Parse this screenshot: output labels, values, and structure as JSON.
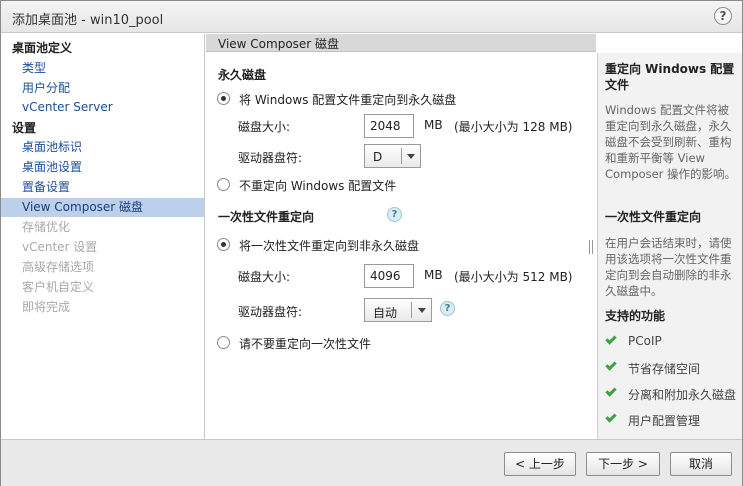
{
  "window": {
    "title": "添加桌面池 - win10_pool",
    "help_label": "?"
  },
  "sidebar": {
    "groups": [
      {
        "label": "桌面池定义"
      },
      {
        "label": "设置"
      }
    ],
    "items": [
      {
        "label": "类型"
      },
      {
        "label": "用户分配"
      },
      {
        "label": "vCenter Server"
      },
      {
        "label": "桌面池标识"
      },
      {
        "label": "桌面池设置"
      },
      {
        "label": "置备设置"
      },
      {
        "label": "View Composer 磁盘"
      },
      {
        "label": "存储优化"
      },
      {
        "label": "vCenter 设置"
      },
      {
        "label": "高级存储选项"
      },
      {
        "label": "客户机自定义"
      },
      {
        "label": "即将完成"
      }
    ]
  },
  "main": {
    "header": "View Composer 磁盘",
    "persistent": {
      "title": "永久磁盘",
      "option_redirect": "将 Windows 配置文件重定向到永久磁盘",
      "disk_size_label": "磁盘大小:",
      "disk_size_value": "2048",
      "disk_size_unit": "MB",
      "disk_size_min": "(最小大小为 128 MB)",
      "drive_label": "驱动器盘符:",
      "drive_value": "D",
      "option_no_redirect": "不重定向 Windows 配置文件"
    },
    "disposable": {
      "title": "一次性文件重定向",
      "option_redirect": "将一次性文件重定向到非永久磁盘",
      "disk_size_label": "磁盘大小:",
      "disk_size_value": "4096",
      "disk_size_unit": "MB",
      "disk_size_min": "(最小大小为 512 MB)",
      "drive_label": "驱动器盘符:",
      "drive_value": "自动",
      "option_no_redirect": "请不要重定向一次性文件"
    }
  },
  "rightpanel": {
    "title1": "重定向 Windows 配置文件",
    "text1": "Windows 配置文件将被重定向到永久磁盘，永久磁盘不会受到刷新、重构和重新平衡等 View Composer 操作的影响。",
    "title2": "一次性文件重定向",
    "text2": "在用户会话结束时，请使用该选项将一次性文件重定向到会自动删除的非永久磁盘中。",
    "title3": "支持的功能",
    "features": [
      "PCoIP",
      "节省存储空间",
      "分离和附加永久磁盘",
      "用户配置管理"
    ]
  },
  "footer": {
    "back": "< 上一步",
    "next": "下一步 >",
    "cancel": "取消"
  },
  "colors": {
    "active_nav": "#bcd0ec",
    "link": "#1a4f9c",
    "check": "#3aa53a"
  }
}
